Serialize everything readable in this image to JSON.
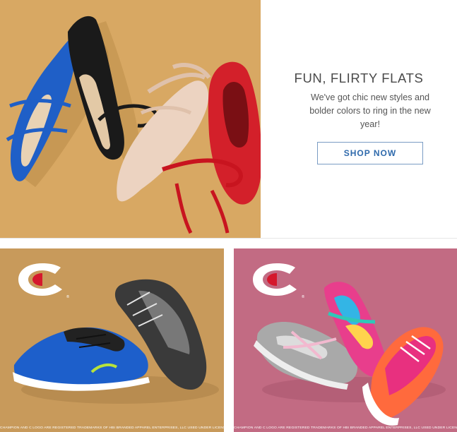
{
  "hero": {
    "title": "FUN, FLIRTY FLATS",
    "subtitle": "We've got chic new styles and bolder colors to ring in the new year!",
    "cta_label": "SHOP NOW",
    "background_color": "#d8a863",
    "accent_color": "#2f6aac",
    "image_subject": "four pointed flats: blue, black, blush, red with ankle ties"
  },
  "promos": [
    {
      "brand_mark": "champion-c-logo",
      "trademark": "®",
      "background_color": "#c89a5b",
      "image_subject": "blue and black/grey athletic sneakers",
      "disclaimer": "CHAMPION AND C LOGO ARE REGISTERED TRADEMARKS OF HBI BRANDED APPAREL ENTERPRISES, LLC USED UNDER LICENSE."
    },
    {
      "brand_mark": "champion-c-logo",
      "trademark": "®",
      "background_color": "#c26b83",
      "image_subject": "grey, multicolor and pink/orange girls sneakers",
      "disclaimer": "CHAMPION AND C LOGO ARE REGISTERED TRADEMARKS OF HBI BRANDED APPAREL ENTERPRISES, LLC USED UNDER LICENSE."
    }
  ]
}
